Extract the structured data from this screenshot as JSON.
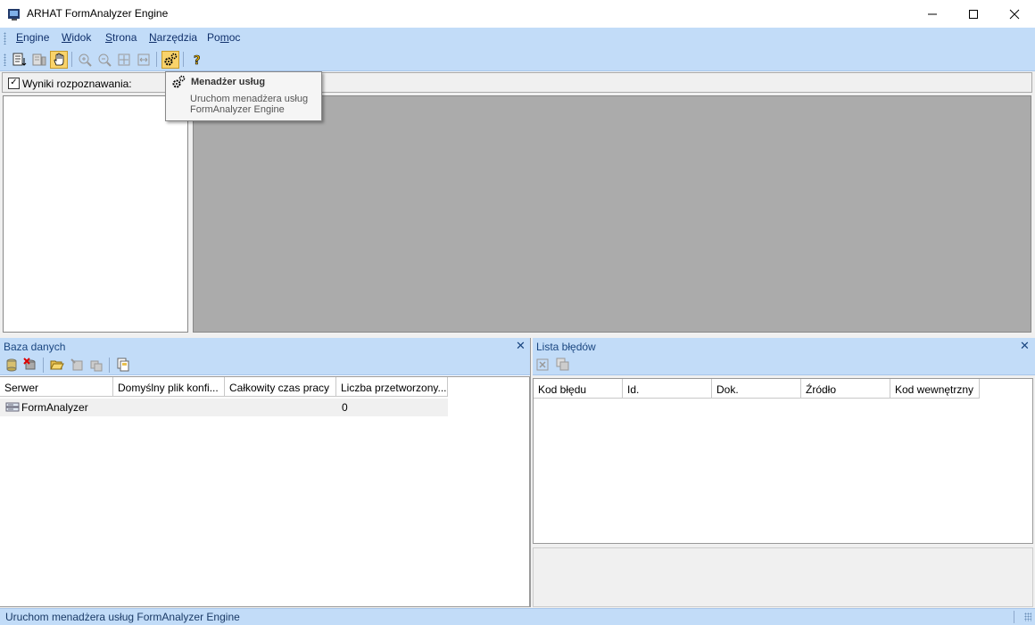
{
  "window": {
    "title": "ARHAT FormAnalyzer Engine",
    "minimize": "—",
    "maximize": "☐",
    "close": "✕"
  },
  "menu": {
    "items": [
      {
        "label": "Engine",
        "accel": "E",
        "rest": "ngine"
      },
      {
        "label": "Widok",
        "accel": "W",
        "rest": "idok"
      },
      {
        "label": "Strona",
        "accel": "S",
        "rest": "trona"
      },
      {
        "label": "Narzędzia",
        "accel": "N",
        "rest": "arzędzia"
      },
      {
        "label": "Pomoc",
        "prefix": "Po",
        "accel": "m",
        "rest": "oc"
      }
    ]
  },
  "toolbar": {
    "icons": [
      "recognize-icon",
      "export-icon",
      "hand-icon",
      "zoom-in-icon",
      "zoom-out-icon",
      "fit-page-icon",
      "fit-width-icon",
      "service-manager-icon",
      "help-icon"
    ]
  },
  "results": {
    "checked": true,
    "label": "Wyniki rozpoznawania:"
  },
  "tooltip": {
    "title": "Menadżer usług",
    "line1": "Uruchom menadżera usług",
    "line2": "FormAnalyzer Engine"
  },
  "database_panel": {
    "title": "Baza danych",
    "close": "✕",
    "columns": [
      "Serwer",
      "Domyślny plik konfi...",
      "Całkowity czas pracy",
      "Liczba przetworzony..."
    ],
    "rows": [
      {
        "server": "FormAnalyzer",
        "config": "",
        "time": "",
        "count": "0"
      }
    ]
  },
  "errors_panel": {
    "title": "Lista błędów",
    "close": "✕",
    "columns": [
      "Kod błędu",
      "Id.",
      "Dok.",
      "Źródło",
      "Kod wewnętrzny"
    ]
  },
  "status": {
    "text": "Uruchom menadżera usług FormAnalyzer Engine"
  }
}
